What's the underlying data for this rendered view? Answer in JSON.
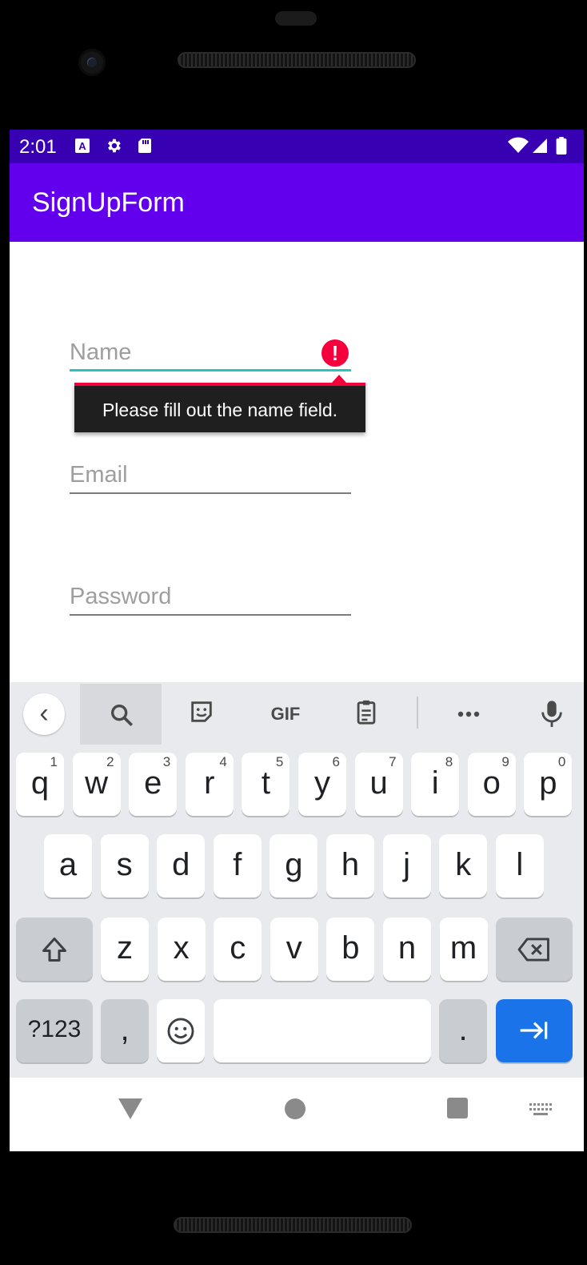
{
  "status_bar": {
    "time": "2:01"
  },
  "app_bar": {
    "title": "SignUpForm"
  },
  "form": {
    "name_placeholder": "Name",
    "email_placeholder": "Email",
    "password_placeholder": "Password",
    "error_tooltip": "Please fill out the name field.",
    "error_color": "#f5003d",
    "focus_color": "#26c6ba"
  },
  "keyboard": {
    "row1": [
      {
        "key": "q",
        "hint": "1"
      },
      {
        "key": "w",
        "hint": "2"
      },
      {
        "key": "e",
        "hint": "3"
      },
      {
        "key": "r",
        "hint": "4"
      },
      {
        "key": "t",
        "hint": "5"
      },
      {
        "key": "y",
        "hint": "6"
      },
      {
        "key": "u",
        "hint": "7"
      },
      {
        "key": "i",
        "hint": "8"
      },
      {
        "key": "o",
        "hint": "9"
      },
      {
        "key": "p",
        "hint": "0"
      }
    ],
    "row2": [
      "a",
      "s",
      "d",
      "f",
      "g",
      "h",
      "j",
      "k",
      "l"
    ],
    "row3": [
      "z",
      "x",
      "c",
      "v",
      "b",
      "n",
      "m"
    ],
    "symbols_label": "?123",
    "comma_label": ",",
    "period_label": ".",
    "toolbar_gif": "GIF",
    "accent_color": "#1a73e8"
  },
  "colors": {
    "status_bar": "#3700b3",
    "app_bar": "#6200ee"
  }
}
